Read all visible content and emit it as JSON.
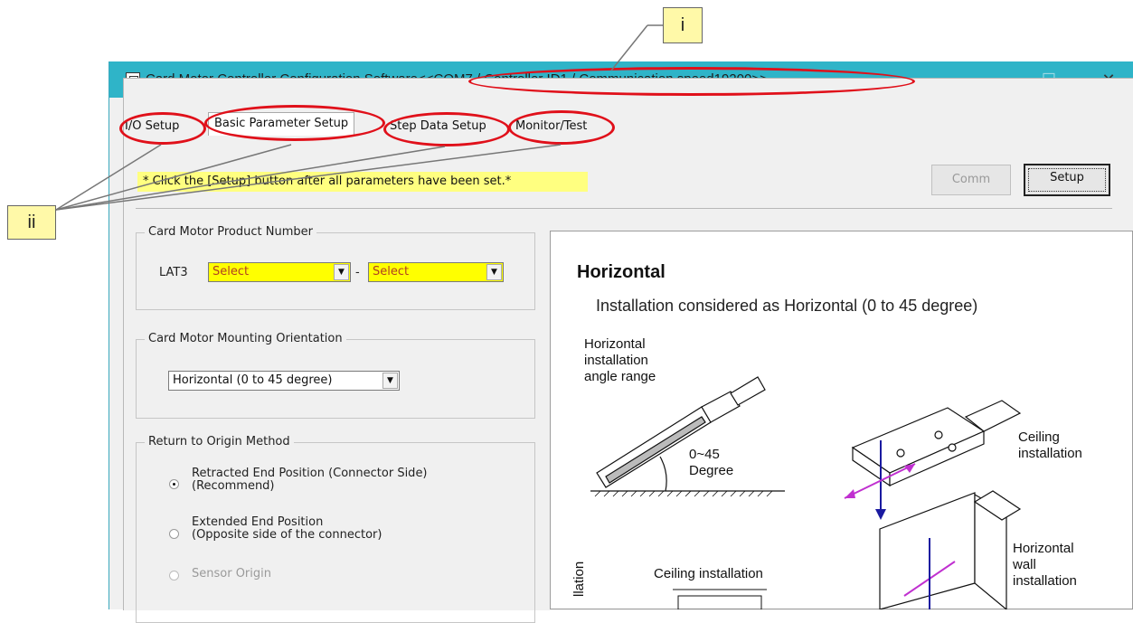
{
  "callouts": {
    "i": "i",
    "ii": "ii"
  },
  "window": {
    "title_prefix": "Card Motor Controller Configuration Software",
    "title_suffix": "<<COM7 / Controller ID1 / Communication speed19200>>",
    "minimize": "—",
    "maximize": "☐",
    "close": "✕"
  },
  "tabs": [
    {
      "label": "I/O Setup"
    },
    {
      "label": "Basic Parameter Setup"
    },
    {
      "label": "Step Data Setup"
    },
    {
      "label": "Monitor/Test"
    }
  ],
  "notice": "* Click the [Setup] button after all parameters have been set.*",
  "buttons": {
    "comm": "Comm",
    "setup": "Setup"
  },
  "product_number": {
    "group_title": "Card Motor Product Number",
    "prefix": "LAT3",
    "dash": "-",
    "select1": "Select",
    "select2": "Select"
  },
  "orientation": {
    "group_title": "Card Motor Mounting Orientation",
    "selected": "Horizontal (0 to 45 degree)"
  },
  "origin": {
    "group_title": "Return to Origin Method",
    "options": [
      {
        "line1": "Retracted End Position (Connector Side)",
        "line2": "(Recommend)",
        "checked": true
      },
      {
        "line1": "Extended End Position",
        "line2": "(Opposite side of the connector)",
        "checked": false
      },
      {
        "line1": "Sensor Origin",
        "line2": "",
        "checked": false
      }
    ]
  },
  "illustration": {
    "heading": "Horizontal",
    "subheading": "Installation considered as Horizontal (0 to 45 degree)",
    "angle_label": [
      "Horizontal",
      "installation",
      "angle range"
    ],
    "range": "0~45",
    "degree": "Degree",
    "ceiling": [
      "Ceiling",
      "installation"
    ],
    "wall": [
      "Horizontal",
      "wall",
      "installation"
    ],
    "ceiling_bottom": "Ceiling installation",
    "rotated": "llation"
  },
  "colors": {
    "titlebar": "#2fb4c8",
    "highlight": "#ffff80",
    "annotation": "#e0101a"
  }
}
